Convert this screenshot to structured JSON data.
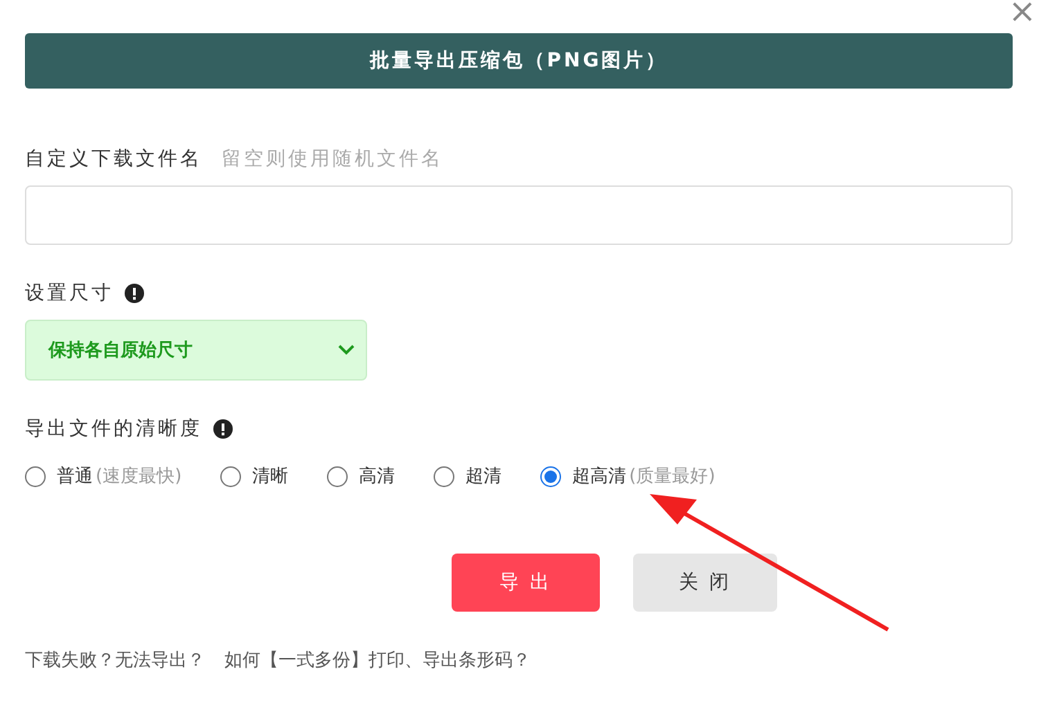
{
  "close_icon": "×",
  "header_button": "批量导出压缩包（PNG图片）",
  "filename": {
    "label": "自定义下载文件名",
    "hint": "留空则使用随机文件名"
  },
  "size": {
    "label": "设置尺寸",
    "value": "保持各自原始尺寸"
  },
  "clarity": {
    "label": "导出文件的清晰度",
    "options": [
      {
        "label": "普通",
        "note": "(速度最快)",
        "selected": false
      },
      {
        "label": "清晰",
        "selected": false
      },
      {
        "label": "高清",
        "selected": false
      },
      {
        "label": "超清",
        "selected": false
      },
      {
        "label": "超高清",
        "note": "(质量最好)",
        "selected": true
      }
    ]
  },
  "buttons": [
    {
      "label": "导 出",
      "kind": "primary"
    },
    {
      "label": "关 闭",
      "kind": "secondary"
    }
  ],
  "footer_links": [
    "下载失败？无法导出？",
    "如何【一式多份】打印、导出条形码？"
  ]
}
